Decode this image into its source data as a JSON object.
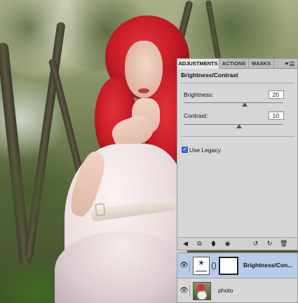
{
  "adjustments_panel": {
    "tabs": [
      {
        "label": "ADJUSTMENTS",
        "active": true
      },
      {
        "label": "ACTIONS",
        "active": false
      },
      {
        "label": "MASKS",
        "active": false
      }
    ],
    "title": "Brightness/Contrast",
    "brightness": {
      "label": "Brightness:",
      "value": "20"
    },
    "contrast": {
      "label": "Contrast:",
      "value": "10"
    },
    "use_legacy": {
      "label": "Use Legacy",
      "checked": true
    }
  },
  "layers_panel": {
    "layers": [
      {
        "name": "Brightness/Con...",
        "selected": true,
        "visible": true
      },
      {
        "name": "photo",
        "selected": false,
        "visible": true
      }
    ]
  },
  "icons": {
    "panel_menu": "panel-menu-icon",
    "eye": "eye-icon",
    "toolbar": [
      "back-arrow-icon",
      "clip-to-layer-icon",
      "visibility-toggle-icon",
      "view-previous-icon",
      "reset-icon",
      "delete-icon"
    ]
  },
  "colors": {
    "panel_bg": "#d6d6d6",
    "selected_layer": "#b8cbe8",
    "checkbox_blue": "#3b6fd6",
    "hair_red": "#c81d28"
  }
}
